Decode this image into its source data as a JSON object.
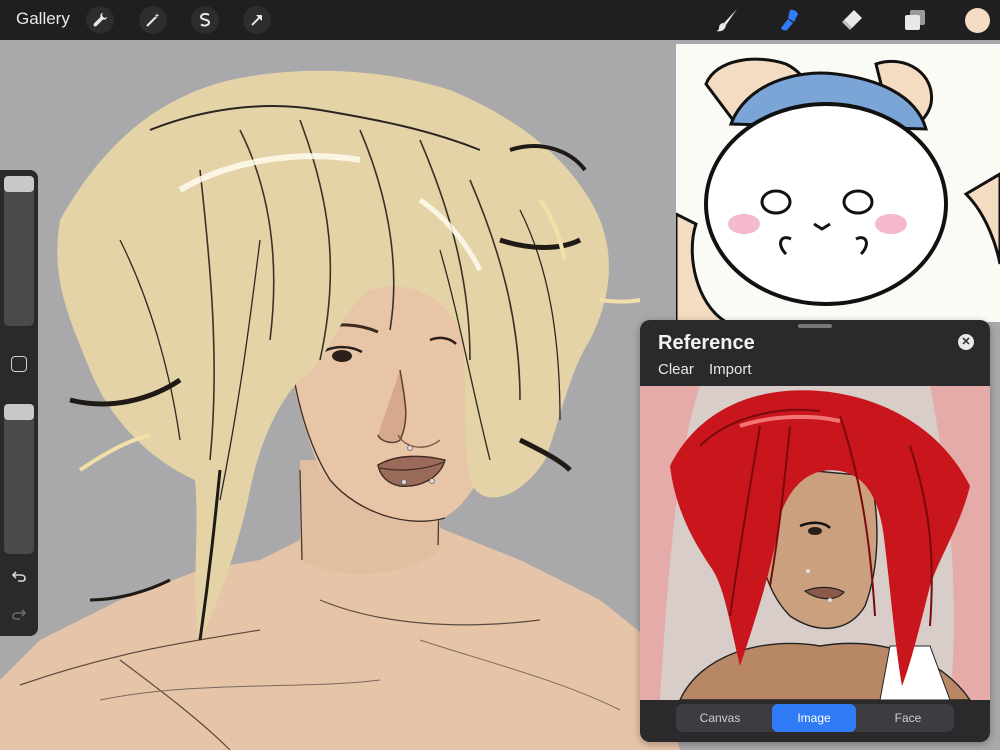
{
  "toolbar": {
    "gallery_label": "Gallery",
    "left_tools": [
      "wrench-icon",
      "magic-wand-icon",
      "selection-icon",
      "transform-arrow-icon"
    ],
    "right_tools": [
      "brush-icon",
      "smudge-icon",
      "eraser-icon",
      "layers-icon"
    ],
    "active_tool": "smudge-icon",
    "active_color": "#f6dcc4",
    "accent_color": "#2f7cf6"
  },
  "sidebar": {
    "size_slider_level": 1.0,
    "opacity_slider_level": 1.0,
    "icons": [
      "modify-square-icon",
      "undo-icon",
      "redo-icon"
    ]
  },
  "reference_panel": {
    "title": "Reference",
    "clear_label": "Clear",
    "import_label": "Import",
    "tabs": [
      "Canvas",
      "Image",
      "Face"
    ],
    "active_tab": "Image"
  }
}
